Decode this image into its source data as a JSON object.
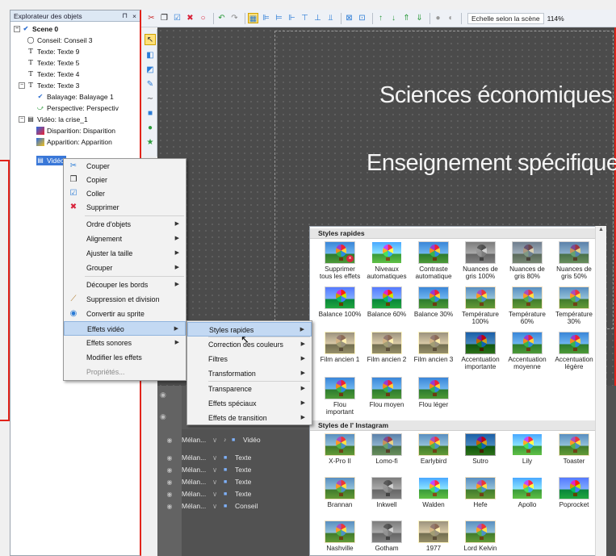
{
  "explorer": {
    "title": "Explorateur des objets",
    "pin": "⊓",
    "close": "×",
    "tree": [
      {
        "label": "Scene 0",
        "icon": "scene-icon"
      },
      {
        "label": "Conseil: Conseil 3",
        "icon": "callout-icon"
      },
      {
        "label": "Texte: Texte 9",
        "icon": "text-icon"
      },
      {
        "label": "Texte: Texte 5",
        "icon": "text-icon"
      },
      {
        "label": "Texte: Texte 4",
        "icon": "text-icon"
      },
      {
        "label": "Texte: Texte 3",
        "icon": "text-icon"
      },
      {
        "label": "Balayage: Balayage 1",
        "icon": "sweep-icon"
      },
      {
        "label": "Perspective: Perspectiv",
        "icon": "perspective-icon"
      },
      {
        "label": "Vidéo: la crise_1",
        "icon": "video-icon"
      },
      {
        "label": "Disparition: Disparition",
        "icon": "effect-icon"
      },
      {
        "label": "Apparition: Apparition",
        "icon": "effect-icon"
      },
      {
        "label": "Vidéo",
        "icon": "video-icon"
      }
    ]
  },
  "toolbar": {
    "scale_label": "Echelle selon la scène",
    "zoom": "114%"
  },
  "canvas": {
    "text1": "Sciences économiques",
    "text2": "Enseignement spécifique"
  },
  "context_menu": {
    "items": [
      {
        "label": "Couper",
        "icon": "scissors-icon"
      },
      {
        "label": "Copier",
        "icon": "copy-icon"
      },
      {
        "label": "Coller",
        "icon": "paste-icon"
      },
      {
        "label": "Supprimer",
        "icon": "delete-icon"
      },
      {
        "label": "Ordre d'objets"
      },
      {
        "label": "Alignement"
      },
      {
        "label": "Ajuster la taille"
      },
      {
        "label": "Grouper"
      },
      {
        "label": "Découper les bords"
      },
      {
        "label": "Suppression et division",
        "icon": "split-icon"
      },
      {
        "label": "Convertir au sprite",
        "icon": "sprite-icon"
      },
      {
        "label": "Effets vidéo"
      },
      {
        "label": "Effets sonores"
      },
      {
        "label": "Modifier les effets"
      },
      {
        "label": "Propriétés..."
      }
    ]
  },
  "submenu": {
    "items": [
      {
        "label": "Styles rapides"
      },
      {
        "label": "Correction des couleurs"
      },
      {
        "label": "Filtres"
      },
      {
        "label": "Transformation"
      },
      {
        "label": "Transparence"
      },
      {
        "label": "Effets spéciaux"
      },
      {
        "label": "Effets de transition"
      }
    ]
  },
  "gallery": {
    "section1": "Styles rapides",
    "section2": "Styles de l' Instagram",
    "quick": [
      {
        "l1": "Supprimer",
        "l2": "tous les effets"
      },
      {
        "l1": "Niveaux",
        "l2": "automatiques"
      },
      {
        "l1": "Contraste",
        "l2": "automatique"
      },
      {
        "l1": "Nuances de",
        "l2": "gris 100%"
      },
      {
        "l1": "Nuances de",
        "l2": "gris 80%"
      },
      {
        "l1": "Nuances de",
        "l2": "gris 50%"
      },
      {
        "l1": "Balance 100%",
        "l2": ""
      },
      {
        "l1": "Balance 60%",
        "l2": ""
      },
      {
        "l1": "Balance 30%",
        "l2": ""
      },
      {
        "l1": "Température",
        "l2": "100%"
      },
      {
        "l1": "Température",
        "l2": "60%"
      },
      {
        "l1": "Température",
        "l2": "30%"
      },
      {
        "l1": "Film ancien 1",
        "l2": ""
      },
      {
        "l1": "Film ancien 2",
        "l2": ""
      },
      {
        "l1": "Film ancien 3",
        "l2": ""
      },
      {
        "l1": "Accentuation",
        "l2": "importante"
      },
      {
        "l1": "Accentuation",
        "l2": "moyenne"
      },
      {
        "l1": "Accentuation",
        "l2": "légère"
      },
      {
        "l1": "Flou",
        "l2": "important"
      },
      {
        "l1": "Flou moyen",
        "l2": ""
      },
      {
        "l1": "Flou léger",
        "l2": ""
      }
    ],
    "instagram": [
      "X-Pro II",
      "Lomo-fi",
      "Earlybird",
      "Sutro",
      "Lily",
      "Toaster",
      "Brannan",
      "Inkwell",
      "Walden",
      "Hefe",
      "Apollo",
      "Poprocket",
      "Nashville",
      "Gotham",
      "1977",
      "Lord Kelvin"
    ]
  },
  "timeline": {
    "tracks": [
      {
        "name": "Mélan...",
        "type": "Vidéo"
      },
      {
        "name": "Mélan...",
        "type": "Texte"
      },
      {
        "name": "Mélan...",
        "type": "Texte"
      },
      {
        "name": "Mélan...",
        "type": "Texte"
      },
      {
        "name": "Mélan...",
        "type": "Texte"
      },
      {
        "name": "Mélan...",
        "type": "Conseil"
      }
    ]
  },
  "colors": {
    "accent_red": "#e2231a",
    "menu_highlight": "#c3d9f3",
    "canvas_bg": "#4b4b4b"
  }
}
